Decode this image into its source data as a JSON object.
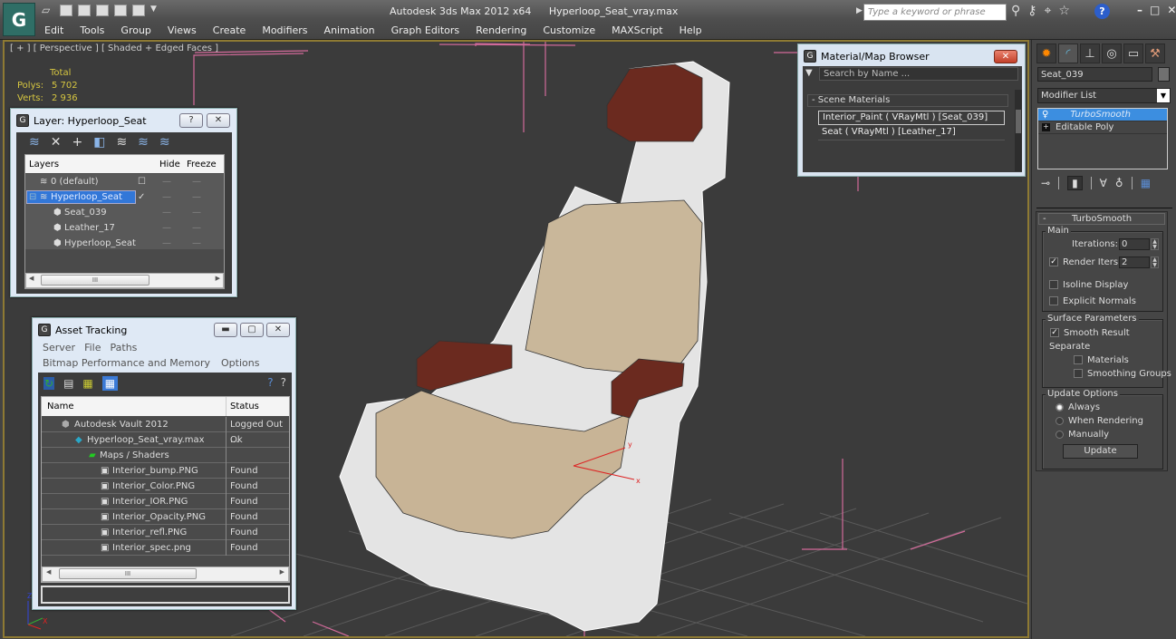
{
  "app": {
    "title": "Autodesk 3ds Max  2012 x64",
    "file": "Hyperloop_Seat_vray.max",
    "logo_icon": "3dsmax-logo-icon",
    "quick_access": [
      "new-scene-icon",
      "open-file-icon",
      "save-file-icon",
      "undo-icon",
      "project-folder-icon",
      "redo-icon",
      "hold-icon",
      "dropdown-arrow-icon"
    ],
    "menu": [
      "Edit",
      "Tools",
      "Group",
      "Views",
      "Create",
      "Modifiers",
      "Animation",
      "Graph Editors",
      "Rendering",
      "Customize",
      "MAXScript",
      "Help"
    ],
    "search_placeholder": "Type a keyword or phrase",
    "toolbar_icons": [
      "binoculars-icon",
      "key-icon",
      "satellite-icon",
      "star-icon"
    ],
    "help_label": "?",
    "window_controls": {
      "minimize": "–",
      "maximize": "□",
      "close": "✕"
    }
  },
  "viewport": {
    "label": "[ + ] [ Perspective ] [ Shaded + Edged Faces ]",
    "stats": {
      "header": "Total",
      "rows": [
        {
          "key": "Polys:",
          "value": "5 702"
        },
        {
          "key": "Verts:",
          "value": "2 936"
        }
      ]
    },
    "gizmo": {
      "x": "X",
      "y": "Y",
      "z": "Z"
    },
    "selection_gizmo": {
      "x": "x",
      "y": "y"
    },
    "colors": {
      "frame": "#8e7a33",
      "background": "#3b3b3b",
      "grid": "#5b5b5b",
      "helper": "#d26a9a",
      "leather": "#6b2a1f",
      "fabric": "#c9b79a",
      "frame_mesh": "#e6e6e6"
    }
  },
  "layer_dialog": {
    "title": "Layer: Hyperloop_Seat",
    "help_btn": "?",
    "close_btn": "✕",
    "tools": [
      "create-layer-icon",
      "delete-layer-icon",
      "add-to-layer-icon",
      "select-objects-icon",
      "highlight-layer-icon",
      "hide-all-icon",
      "freeze-all-icon"
    ],
    "columns": [
      "Layers",
      "",
      "Hide",
      "Freeze"
    ],
    "rows": [
      {
        "name": "0 (default)",
        "indent": 1,
        "type": "layer",
        "current": "☐",
        "hide": "—",
        "freeze": "—",
        "selected": false
      },
      {
        "name": "Hyperloop_Seat",
        "indent": 0,
        "type": "layer",
        "current": "✓",
        "hide": "—",
        "freeze": "—",
        "selected": true,
        "expander": "⊟"
      },
      {
        "name": "Seat_039",
        "indent": 2,
        "type": "object",
        "current": "",
        "hide": "—",
        "freeze": "—",
        "selected": false
      },
      {
        "name": "Leather_17",
        "indent": 2,
        "type": "object",
        "current": "",
        "hide": "—",
        "freeze": "—",
        "selected": false
      },
      {
        "name": "Hyperloop_Seat",
        "indent": 2,
        "type": "object",
        "current": "",
        "hide": "—",
        "freeze": "—",
        "selected": false
      }
    ],
    "scroll_thumb": "III"
  },
  "asset_tracking": {
    "title": "Asset Tracking",
    "window_btns": {
      "minimize": "▬",
      "restore": "▢",
      "close": "✕"
    },
    "menu_row1": [
      "Server",
      "File",
      "Paths"
    ],
    "menu_row2": [
      "Bitmap Performance and Memory",
      "Options"
    ],
    "tools": [
      "refresh-icon",
      "list-icon",
      "tree-icon",
      "table-view-icon"
    ],
    "help_tools": [
      "help-globe-icon",
      "help-icon"
    ],
    "columns": [
      "Name",
      "Status"
    ],
    "rows": [
      {
        "name": "Autodesk Vault 2012",
        "status": "Logged Out ...",
        "indent": 1,
        "icon": "vault-icon"
      },
      {
        "name": "Hyperloop_Seat_vray.max",
        "status": "Ok",
        "indent": 2,
        "icon": "max-file-icon"
      },
      {
        "name": "Maps / Shaders",
        "status": "",
        "indent": 3,
        "icon": "maps-folder-icon"
      },
      {
        "name": "Interior_bump.PNG",
        "status": "Found",
        "indent": 4,
        "icon": "png-file-icon"
      },
      {
        "name": "Interior_Color.PNG",
        "status": "Found",
        "indent": 4,
        "icon": "png-file-icon"
      },
      {
        "name": "Interior_IOR.PNG",
        "status": "Found",
        "indent": 4,
        "icon": "png-file-icon"
      },
      {
        "name": "Interior_Opacity.PNG",
        "status": "Found",
        "indent": 4,
        "icon": "png-file-icon"
      },
      {
        "name": "Interior_refl.PNG",
        "status": "Found",
        "indent": 4,
        "icon": "png-file-icon"
      },
      {
        "name": "Interior_spec.png",
        "status": "Found",
        "indent": 4,
        "icon": "png-file-icon"
      }
    ],
    "scroll_thumb": "III",
    "path_field": ""
  },
  "material_browser": {
    "title": "Material/Map Browser",
    "close_btn": "✕",
    "search_placeholder": "Search by Name ...",
    "group": "- Scene Materials",
    "items": [
      {
        "label": "Interior_Paint  ( VRayMtl )  [Seat_039]",
        "selected": true
      },
      {
        "label": "Seat  ( VRayMtl )  [Leather_17]",
        "selected": false
      }
    ]
  },
  "command_panel": {
    "tabs": [
      "create-icon",
      "modify-icon",
      "hierarchy-icon",
      "motion-icon",
      "display-icon",
      "utilities-icon"
    ],
    "object_name": "Seat_039",
    "modifier_list": "Modifier List",
    "stack": [
      {
        "label": "TurboSmooth",
        "selected": true,
        "icon": "lightbulb-icon"
      },
      {
        "label": "Editable Poly",
        "selected": false,
        "icon": "expand-plus-icon"
      }
    ],
    "stack_tools": [
      "pin-stack-icon",
      "show-end-result-icon",
      "make-unique-icon",
      "remove-modifier-icon",
      "configure-sets-icon"
    ],
    "rollout": {
      "title": "TurboSmooth",
      "collapse": "-",
      "main": {
        "label": "Main",
        "iterations_label": "Iterations:",
        "iterations": "0",
        "render_iters_label": "Render Iters:",
        "render_iters": "2",
        "render_iters_checked": true,
        "isoline_label": "Isoline Display",
        "isoline_checked": false,
        "explicit_normals_label": "Explicit Normals",
        "explicit_normals_checked": false
      },
      "surface": {
        "label": "Surface Parameters",
        "smooth_result_label": "Smooth Result",
        "smooth_result_checked": true,
        "separate_label": "Separate",
        "materials_label": "Materials",
        "materials_checked": false,
        "smoothing_groups_label": "Smoothing Groups",
        "smoothing_groups_checked": false
      },
      "update": {
        "label": "Update Options",
        "options": [
          "Always",
          "When Rendering",
          "Manually"
        ],
        "selected": "Always",
        "button": "Update"
      }
    }
  }
}
